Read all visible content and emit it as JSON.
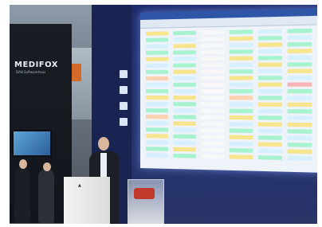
{
  "photo": {
    "booth_logo": "MEDIFOX",
    "booth_logo_tagline": "DAN Softwarehaus"
  },
  "screen_columns": [
    [
      "#f6e58d",
      "#a7f3d0",
      "#d7f0ff",
      "#a7f3d0",
      "#f6e58d",
      "#d7f0ff",
      "#a7f3d0",
      "#fbd3b0",
      "#d7f0ff",
      "#a7f3d0",
      "#f6e58d",
      "#d7f0ff",
      "#a7f3d0",
      "#fbd3b0",
      "#d7f0ff",
      "#a7f3d0",
      "#f6e58d",
      "#d7f0ff",
      "#a7f3d0",
      "#d7f0ff"
    ],
    [
      "#a7f3d0",
      "#d7f0ff",
      "#f6e58d",
      "#a7f3d0",
      "#d7f0ff",
      "#a7f3d0",
      "#f6e58d",
      "#d7f0ff",
      "#a7f3d0",
      "#d7f0ff",
      "#f6e58d",
      "#a7f3d0",
      "#d7f0ff",
      "#a7f3d0",
      "#f6e58d",
      "#d7f0ff",
      "#a7f3d0",
      "#d7f0ff",
      "#f6e58d",
      "#a7f3d0"
    ],
    [
      "#f8f8f8",
      "#f8f8f8",
      "#f8f8f8",
      "#f8f8f8",
      "#f8f8f8",
      "#f8f8f8",
      "#f8f8f8",
      "#f8f8f8",
      "#f8f8f8",
      "#f8f8f8",
      "#f8f8f8",
      "#f8f8f8",
      "#f8f8f8",
      "#f8f8f8",
      "#f8f8f8",
      "#f8f8f8",
      "#f8f8f8",
      "#f8f8f8",
      "#f8f8f8",
      "#f8f8f8"
    ],
    [
      "#a7f3d0",
      "#f6e58d",
      "#d7f0ff",
      "#a7f3d0",
      "#f6e58d",
      "#d7f0ff",
      "#a7f3d0",
      "#f6e58d",
      "#d7f0ff",
      "#a7f3d0",
      "#fbd3b0",
      "#d7f0ff",
      "#a7f3d0",
      "#f6e58d",
      "#d7f0ff",
      "#a7f3d0",
      "#f6e58d",
      "#d7f0ff",
      "#a7f3d0",
      "#f6e58d"
    ],
    [
      "#d7f0ff",
      "#a7f3d0",
      "#f6e58d",
      "#d7f0ff",
      "#a7f3d0",
      "#f6e58d",
      "#d7f0ff",
      "#a7f3d0",
      "#f6e58d",
      "#d7f0ff",
      "#a7f3d0",
      "#f6e58d",
      "#d7f0ff",
      "#a7f3d0",
      "#f6e58d",
      "#d7f0ff",
      "#a7f3d0",
      "#f6e58d",
      "#d7f0ff",
      "#a7f3d0"
    ],
    [
      "#a7f3d0",
      "#d7f0ff",
      "#a7f3d0",
      "#f6e58d",
      "#d7f0ff",
      "#a7f3d0",
      "#f6e58d",
      "#d7f0ff",
      "#f8b4b4",
      "#a7f3d0",
      "#d7f0ff",
      "#f6e58d",
      "#a7f3d0",
      "#d7f0ff",
      "#f6e58d",
      "#a7f3d0",
      "#d7f0ff",
      "#a7f3d0",
      "#f6e58d",
      "#d7f0ff"
    ]
  ]
}
